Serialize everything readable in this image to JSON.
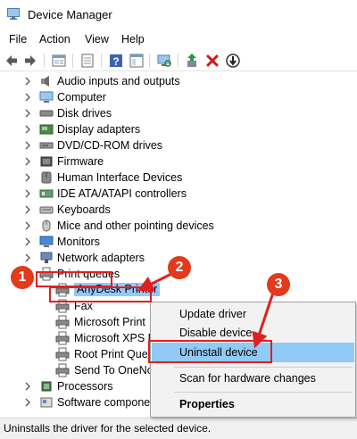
{
  "window": {
    "title": "Device Manager"
  },
  "menu": [
    "File",
    "Action",
    "View",
    "Help"
  ],
  "toolbar": {
    "icons": [
      "back-icon",
      "forward-icon",
      "properties-icon",
      "show-hidden-icon",
      "help-icon",
      "show-hide-console-icon",
      "scan-hardware-icon",
      "update-driver-icon",
      "uninstall-icon",
      "disable-icon"
    ]
  },
  "tree": {
    "categories": [
      {
        "label": "Audio inputs and outputs",
        "icon": "speaker-icon"
      },
      {
        "label": "Computer",
        "icon": "computer-icon"
      },
      {
        "label": "Disk drives",
        "icon": "disk-drive-icon"
      },
      {
        "label": "Display adapters",
        "icon": "display-adapter-icon"
      },
      {
        "label": "DVD/CD-ROM drives",
        "icon": "dvd-drive-icon"
      },
      {
        "label": "Firmware",
        "icon": "firmware-icon"
      },
      {
        "label": "Human Interface Devices",
        "icon": "hid-icon"
      },
      {
        "label": "IDE ATA/ATAPI controllers",
        "icon": "ide-controller-icon"
      },
      {
        "label": "Keyboards",
        "icon": "keyboard-icon"
      },
      {
        "label": "Mice and other pointing devices",
        "icon": "mouse-icon"
      },
      {
        "label": "Monitors",
        "icon": "monitor-icon"
      },
      {
        "label": "Network adapters",
        "icon": "network-adapter-icon"
      },
      {
        "label": "Print queues",
        "icon": "printer-icon",
        "expanded": true
      }
    ],
    "print_queue_children": [
      {
        "label": "AnyDesk Printer",
        "selected": true
      },
      {
        "label": "Fax"
      },
      {
        "label": "Microsoft Print"
      },
      {
        "label": "Microsoft XPS D"
      },
      {
        "label": "Root Print Queu"
      },
      {
        "label": "Send To OneNo"
      }
    ],
    "after": [
      {
        "label": "Processors",
        "icon": "processor-icon"
      },
      {
        "label": "Software compone",
        "icon": "software-component-icon"
      }
    ]
  },
  "context_menu": {
    "items": [
      {
        "label": "Update driver"
      },
      {
        "label": "Disable device"
      },
      {
        "label": "Uninstall device",
        "highlighted": true
      },
      {
        "label": "Scan for hardware changes"
      },
      {
        "label": "Properties",
        "bold": true
      }
    ]
  },
  "status_bar": {
    "text": "Uninstalls the driver for the selected device."
  },
  "annotations": {
    "steps": [
      "1",
      "2",
      "3"
    ],
    "color": "#e02020"
  },
  "colors": {
    "selection": "#91c9f7",
    "annotation": "#e02020",
    "badge": "#e23a1c"
  }
}
